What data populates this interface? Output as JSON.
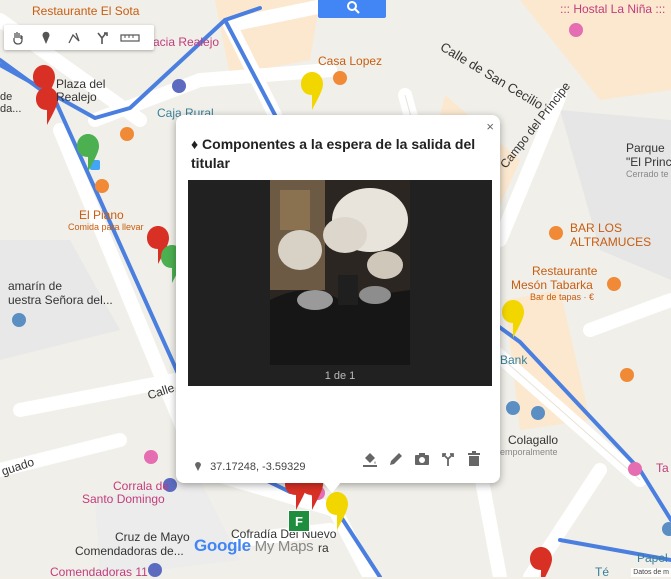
{
  "map_labels": {
    "restaurante_el_sota": "Restaurante El Sota",
    "hostal_la_nina": "::: Hostal La Niña :::",
    "calle_san_cecilio": "Calle de San Cecilio",
    "farmacia_realejo": "Farmacia Realejo",
    "casa_lopez": "Casa Lopez",
    "plaza_del_realejo_1": "Plaza del",
    "plaza_del_realejo_2": "Realejo",
    "realejo_left": "de\nda...",
    "caja_rural": "Caja Rural",
    "campo_del_principe": "Campo del Príncipe",
    "parque_1": "Parque",
    "parque_2": "\"El Princ",
    "parque_3": "Cerrado te",
    "el_piano": "El Piano",
    "el_piano_sub": "Comida para llevar",
    "bar_los_altramuces_1": "BAR LOS",
    "bar_los_altramuces_2": "ALTRAMUCES",
    "camarin_1": "amarín de",
    "camarin_2": "uestra Señora del...",
    "restaurante_meson_1": "Restaurante",
    "restaurante_meson_2": "Mesón Tabarka",
    "restaurante_meson_sub": "Bar de tapas · €",
    "bank": "Bank",
    "calle_left": "Calle",
    "colagallo": "Colagallo",
    "colagallo_sub": "emporalmente",
    "guado": "guado",
    "ta": "Ta",
    "corrala_1": "Corrala de",
    "corrala_2": "Santo Domingo",
    "cruz_de_mayo_1": "Cruz de Mayo",
    "cruz_de_mayo_2": "Comendadoras de...",
    "cofradia": "Cofradía Del Nuevo",
    "cofradia_2": "ra",
    "comendadoras_11": "Comendadoras 11",
    "papel": "Papel",
    "te": "Té"
  },
  "toolbar": {
    "tools": [
      "hand-icon",
      "marker-icon",
      "line-icon",
      "route-icon",
      "ruler-icon"
    ]
  },
  "popup": {
    "title": "♦ Componentes a la espera de la salida del titular",
    "close": "×",
    "counter": "1 de 1",
    "coords": "37.17248, -3.59329",
    "actions": [
      "style-icon",
      "edit-icon",
      "camera-icon",
      "directions-icon",
      "delete-icon"
    ]
  },
  "route_marker": "F",
  "google_logo": {
    "google": "Google",
    "my_maps": " My Maps"
  },
  "attribution": "Datos de m",
  "colors": {
    "route": "#4a7fe0",
    "pin_red": "#d93025",
    "pin_yellow": "#f2d600",
    "pin_green": "#4caf50",
    "poi_orange": "#f08a36"
  }
}
